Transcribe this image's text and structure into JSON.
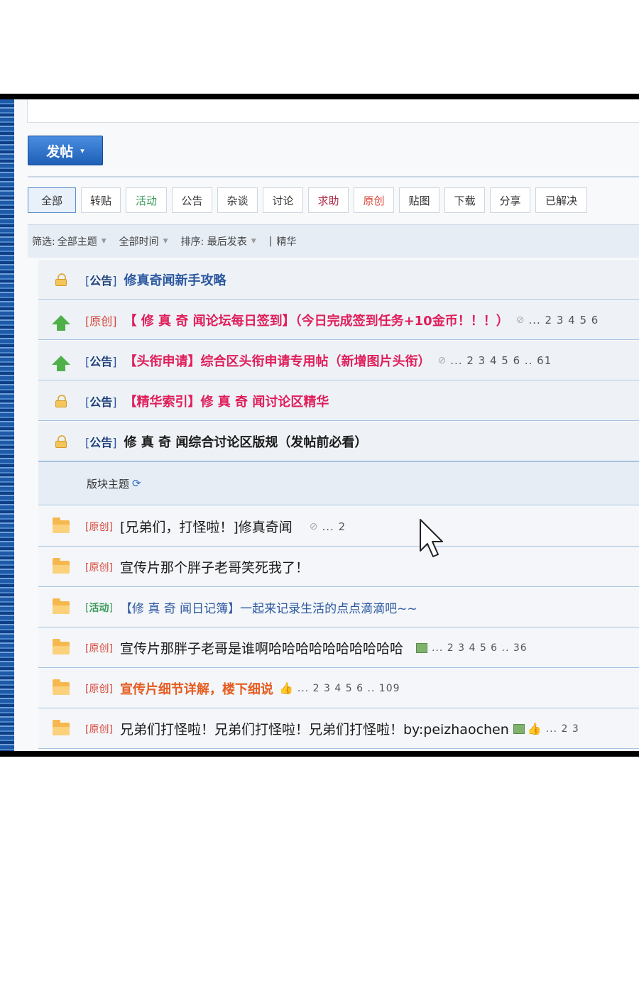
{
  "toolbar": {
    "post_label": "发帖",
    "post_caret": "▾"
  },
  "tabs": [
    {
      "label": "全部",
      "color": "#333333",
      "active": true
    },
    {
      "label": "转贴",
      "color": "#333333"
    },
    {
      "label": "活动",
      "color": "#3a9a5a"
    },
    {
      "label": "公告",
      "color": "#333333"
    },
    {
      "label": "杂谈",
      "color": "#333333"
    },
    {
      "label": "讨论",
      "color": "#333333"
    },
    {
      "label": "求助",
      "color": "#b0304a"
    },
    {
      "label": "原创",
      "color": "#d8473a"
    },
    {
      "label": "贴图",
      "color": "#333333"
    },
    {
      "label": "下载",
      "color": "#333333"
    },
    {
      "label": "分享",
      "color": "#333333"
    },
    {
      "label": "已解决",
      "color": "#333333"
    }
  ],
  "filter": {
    "label": "筛选:",
    "topic": "全部主题",
    "time": "全部时间",
    "sort": "排序: 最后发表",
    "divider": "|",
    "digest": "精华"
  },
  "sticky": [
    {
      "cat_open": "[",
      "cat": "公告",
      "cat_close": "]",
      "title": "修真奇闻新手攻略",
      "pages": ""
    },
    {
      "cat_open": "[",
      "cat": "原创",
      "cat_close": "]",
      "title": "【 修 真 奇 闻论坛每日签到】（今日完成签到任务+10金币！！！）",
      "pages": "... 2 3 4 5 6"
    },
    {
      "cat_open": "[",
      "cat": "公告",
      "cat_close": "]",
      "title": "【头衔申请】综合区头衔申请专用帖（新增图片头衔）",
      "pages": "... 2 3 4 5 6 .. 61"
    },
    {
      "cat_open": "[",
      "cat": "公告",
      "cat_close": "]",
      "title": "【精华索引】修 真 奇 闻讨论区精华",
      "pages": ""
    },
    {
      "cat_open": "[",
      "cat": "公告",
      "cat_close": "]",
      "title": "修 真 奇 闻综合讨论区版规（发帖前必看）",
      "pages": ""
    }
  ],
  "section": {
    "label": "版块主题",
    "refresh_icon": "⟳"
  },
  "threads": [
    {
      "cat_open": "[",
      "cat": "原创",
      "cat_close": "]",
      "title": "[兄弟们，打怪啦！]修真奇闻",
      "pages": "... 2"
    },
    {
      "cat_open": "[",
      "cat": "原创",
      "cat_close": "]",
      "title": "宣传片那个胖子老哥笑死我了！",
      "pages": ""
    },
    {
      "cat_open": "[",
      "cat": "活动",
      "cat_close": "]",
      "title": "【修 真 奇 闻日记簿】一起来记录生活的点点滴滴吧~~",
      "pages": ""
    },
    {
      "cat_open": "[",
      "cat": "原创",
      "cat_close": "]",
      "title": "宣传片那胖子老哥是谁啊哈哈哈哈哈哈哈哈哈哈",
      "pages": "... 2 3 4 5 6 .. 36"
    },
    {
      "cat_open": "[",
      "cat": "原创",
      "cat_close": "]",
      "title": "宣传片细节详解，楼下细说",
      "pages": "... 2 3 4 5 6 .. 109"
    },
    {
      "cat_open": "[",
      "cat": "原创",
      "cat_close": "]",
      "title": "兄弟们打怪啦！兄弟们打怪啦！兄弟们打怪啦！by:peizhaochen",
      "pages": "... 2 3"
    }
  ]
}
